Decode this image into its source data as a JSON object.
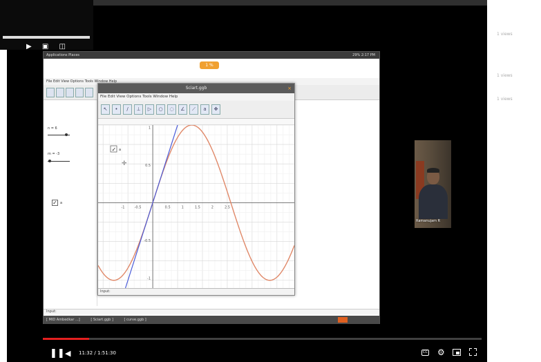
{
  "page_right_panel": {
    "row_1": "1 views",
    "row_2": "1 views",
    "row_3": "1 views"
  },
  "desktop": {
    "topbar_left": "Applications  Places",
    "topbar_right": "29%  2:17 PM",
    "zoom_pill": "1 %",
    "main_menu": "File  Edit  View  Options  Tools  Window  Help",
    "sliders": [
      {
        "label": "n = 6",
        "value": 0.85
      },
      {
        "label": "m = -3",
        "value": 0.1
      }
    ],
    "checkbox_label": "a",
    "input_label": "Input:",
    "taskbar_items": [
      "[ MID Ambedkar ...]",
      "[ Sciart.ggb ]",
      "[ curve.ggb ]"
    ]
  },
  "geogebra_window": {
    "title": "Sciart.ggb",
    "menu": "File  Edit  View  Options  Tools  Window  Help",
    "checkbox_label": "a",
    "input_label": "Input:"
  },
  "chart_data": {
    "type": "line",
    "xlim": [
      -2.2,
      5.7
    ],
    "ylim": [
      -1.1,
      1.0
    ],
    "x_ticks": [
      "-1",
      "-0.5",
      "0.5",
      "1",
      "1.5",
      "2",
      "2.5"
    ],
    "y_ticks": [
      "1",
      "0.5",
      "-0.5",
      "-1"
    ],
    "series": [
      {
        "function": "sin(x)",
        "color": "#e08868"
      },
      {
        "function": "x",
        "color": "#4a5bd8"
      }
    ]
  },
  "webcam": {
    "participant_name": "Ramanujam R"
  },
  "player": {
    "progress": 0.105,
    "current_time": "11:32 / 1:51:30",
    "cc_label": "CC"
  },
  "colors": {
    "progress": "#e52020",
    "curve_sin": "#e08868",
    "line_identity": "#4a5bd8"
  }
}
